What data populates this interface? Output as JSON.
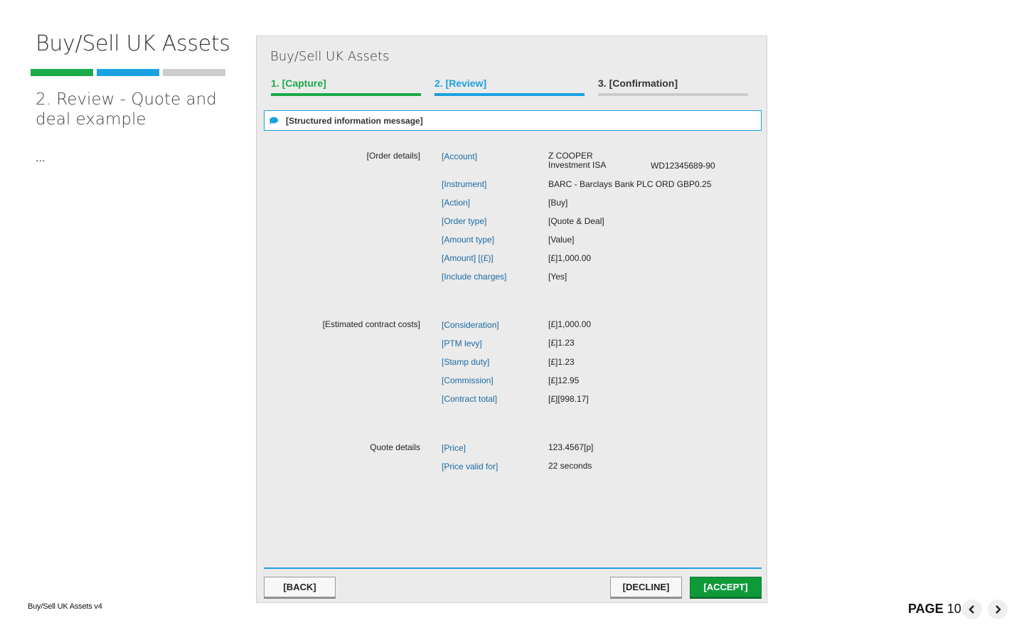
{
  "sidebar": {
    "title": "Buy/Sell UK Assets",
    "subtitle": "2. Review - Quote and deal example",
    "ellipsis": "...",
    "progress_colors": [
      "#1aaa4a",
      "#1ba1e2",
      "#cccccc"
    ]
  },
  "footer": {
    "doc_label": "Buy/Sell UK Assets v4",
    "page_word": "PAGE",
    "page_number": "10"
  },
  "panel": {
    "title": "Buy/Sell UK Assets",
    "steps": [
      {
        "label": "1. [Capture]",
        "color": "#1aaa4a"
      },
      {
        "label": "2. [Review]",
        "color": "#1ba1e2"
      },
      {
        "label": "3. [Confirmation]",
        "color": "#333333",
        "bar_color": "#cccccc"
      }
    ],
    "message": "[Structured information message]",
    "order_details": {
      "section": "[Order details]",
      "account_label": "[Account]",
      "account_name": "Z COOPER",
      "account_type": "Investment ISA",
      "account_number": "WD12345689-90",
      "rows": [
        {
          "label": "[Instrument]",
          "value": "BARC - Barclays Bank PLC ORD GBP0.25"
        },
        {
          "label": "[Action]",
          "value": "[Buy]"
        },
        {
          "label": "[Order type]",
          "value": "[Quote & Deal]"
        },
        {
          "label": "[Amount type]",
          "value": "[Value]"
        },
        {
          "label": "[Amount] [(£)]",
          "value": "[£]1,000.00"
        },
        {
          "label": "[Include charges]",
          "value": "[Yes]"
        }
      ]
    },
    "costs": {
      "section": "[Estimated contract costs]",
      "rows": [
        {
          "label": "[Consideration]",
          "value": "[£]1,000.00"
        },
        {
          "label": "[PTM levy]",
          "value": "[£]1.23"
        },
        {
          "label": "[Stamp duty]",
          "value": "[£]1.23"
        },
        {
          "label": "[Commission]",
          "value": "[£]12.95"
        },
        {
          "label": "[Contract total]",
          "value": "[£][998.17]"
        }
      ]
    },
    "quote": {
      "section": "Quote details",
      "rows": [
        {
          "label": "[Price]",
          "value": "123.4567[p]"
        },
        {
          "label": "[Price valid for]",
          "value": "22 seconds"
        }
      ]
    },
    "buttons": {
      "back": "[BACK]",
      "decline": "[DECLINE]",
      "accept": "[ACCEPT]"
    }
  },
  "icons": {
    "message": "speech-bubble-icon",
    "prev": "chevron-left-icon",
    "next": "chevron-right-icon"
  }
}
